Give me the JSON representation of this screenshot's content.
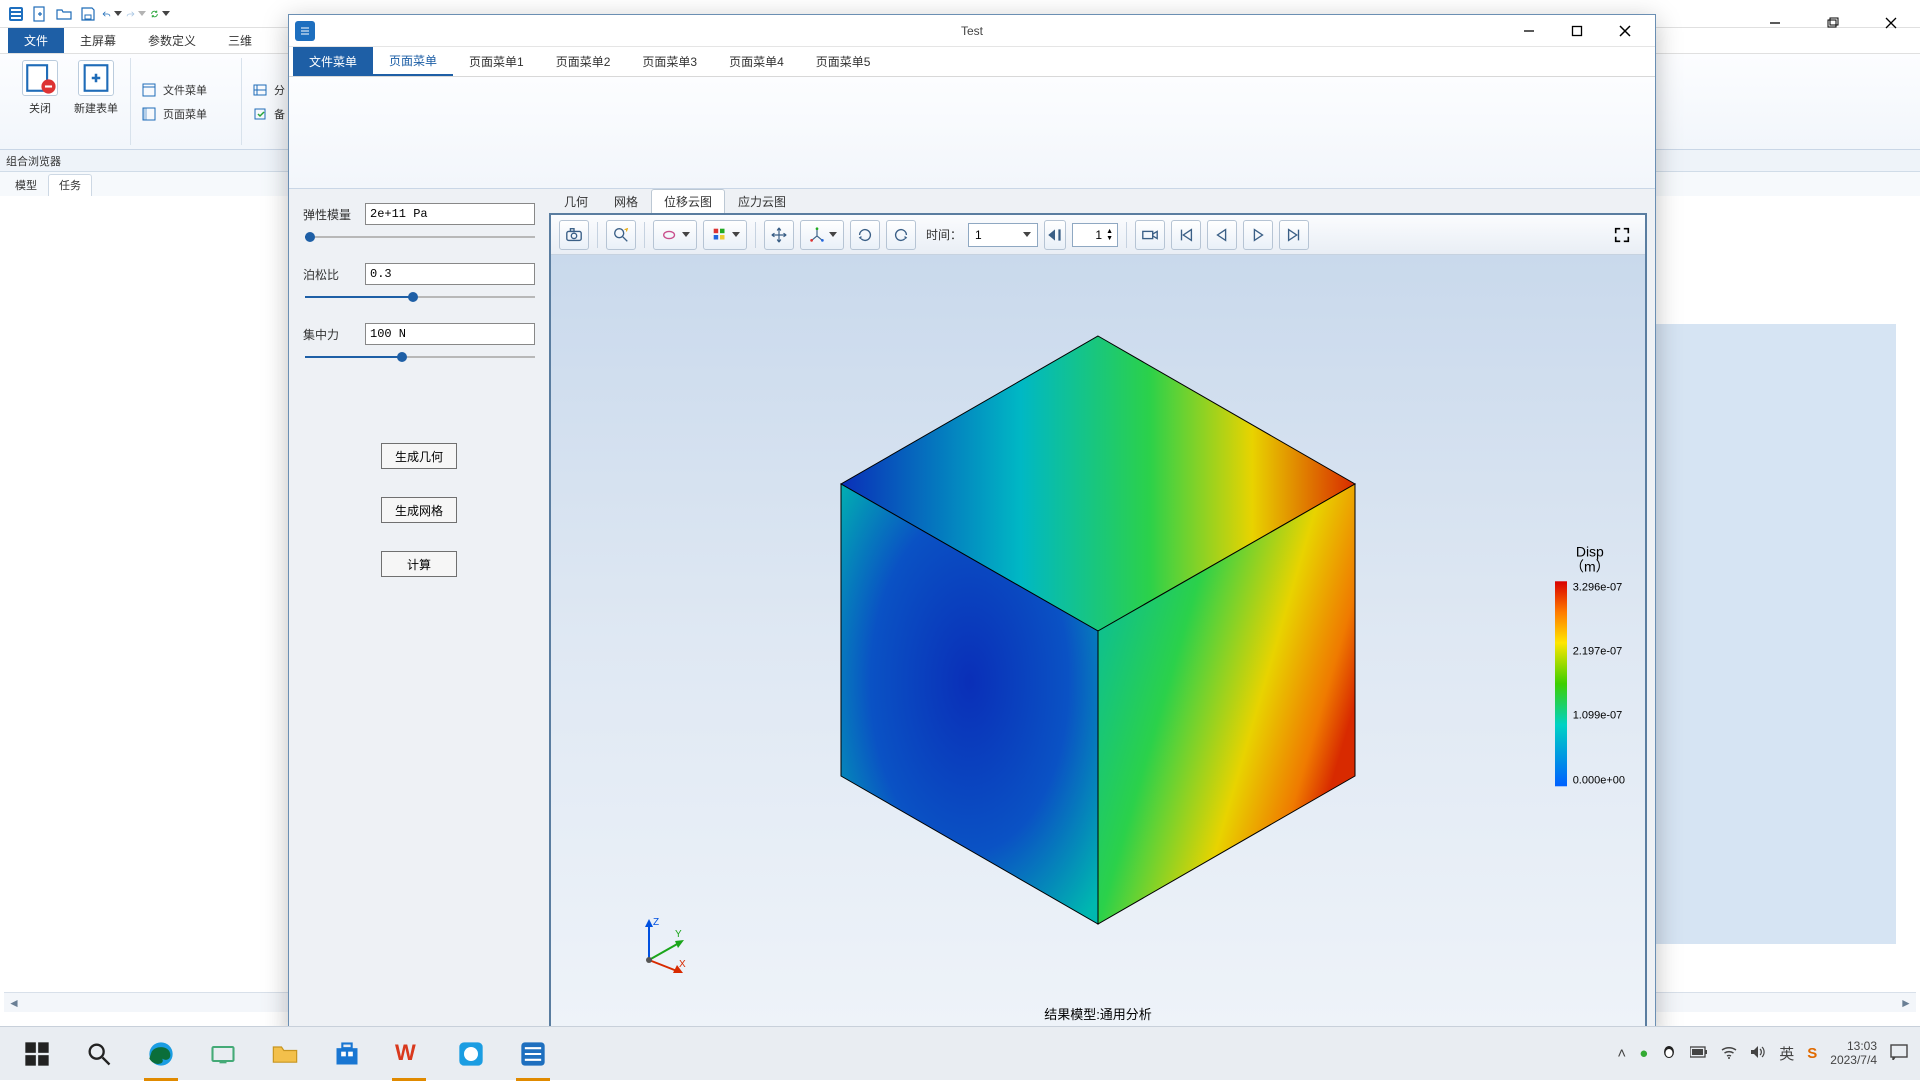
{
  "outer": {
    "ribbon_tabs": {
      "file": "文件",
      "home": "主屏幕",
      "param": "参数定义",
      "three_d": "三维"
    },
    "big_buttons": {
      "close": "关闭",
      "new_form": "新建表单"
    },
    "small_buttons": {
      "file_menu": "文件菜单",
      "page_menu": "页面菜单",
      "extra": "分"
    },
    "browser_title": "组合浏览器",
    "browser_tabs": {
      "model": "模型",
      "task": "任务"
    }
  },
  "inner": {
    "title": "Test",
    "tabs": {
      "file": "文件菜单",
      "page": "页面菜单",
      "page1": "页面菜单1",
      "page2": "页面菜单2",
      "page3": "页面菜单3",
      "page4": "页面菜单4",
      "page5": "页面菜单5"
    },
    "params": {
      "modulus_label": "弹性模量",
      "modulus_value": "2e+11 Pa",
      "poisson_label": "泊松比",
      "poisson_value": "0.3",
      "force_label": "集中力",
      "force_value": "100 N"
    },
    "buttons": {
      "gen_geom": "生成几何",
      "gen_mesh": "生成网格",
      "compute": "计算"
    },
    "viz_tabs": {
      "geom": "几何",
      "mesh": "网格",
      "disp": "位移云图",
      "stress": "应力云图"
    },
    "toolbar": {
      "time_label": "时间：",
      "time_combo": "1",
      "time_spin": "1"
    },
    "result_label": "结果模型:通用分析",
    "legend": {
      "title_line1": "Disp",
      "title_line2": "（m）",
      "t3": "3.296e-07",
      "t2": "2.197e-07",
      "t1": "1.099e-07",
      "t0": "0.000e+00"
    }
  },
  "taskbar": {
    "ime": "英",
    "time": "13:03",
    "date": "2023/7/4"
  }
}
